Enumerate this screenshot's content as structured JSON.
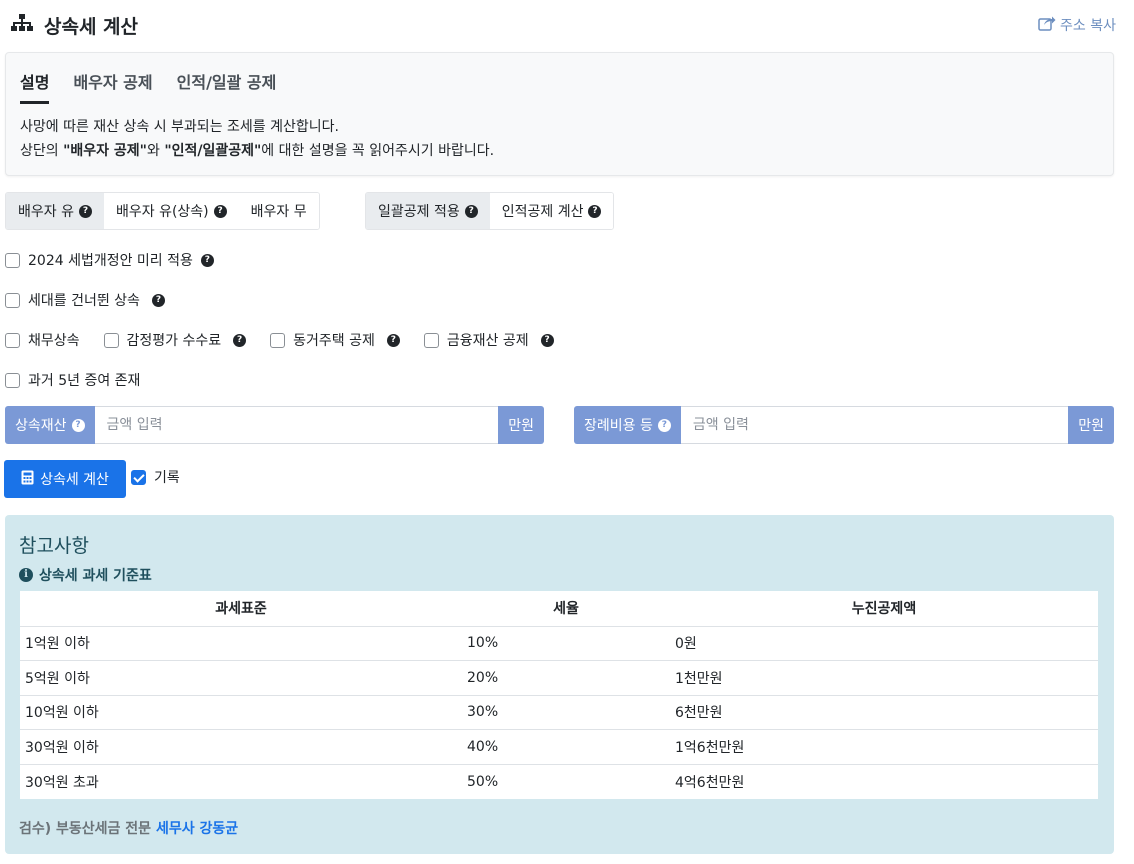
{
  "header": {
    "title": "상속세 계산",
    "share_label": "주소 복사",
    "title_icon": "sitemap-icon",
    "share_icon": "share-icon"
  },
  "desc": {
    "tabs": [
      {
        "label": "설명",
        "active": true
      },
      {
        "label": "배우자 공제",
        "active": false
      },
      {
        "label": "인적/일괄 공제",
        "active": false
      }
    ],
    "line1": "사망에 따른 재산 상속 시 부과되는 조세를 계산합니다.",
    "line2_prefix": "상단의 ",
    "line2_b1": "\"배우자 공제\"",
    "line2_mid": "와 ",
    "line2_b2": "\"인적/일괄공제\"",
    "line2_suffix": "에 대한 설명을 꼭 읽어주시기 바랍니다."
  },
  "spouse_options": [
    {
      "label": "배우자 유",
      "help": true,
      "active": true
    },
    {
      "label": "배우자 유(상속)",
      "help": true,
      "active": false
    },
    {
      "label": "배우자 무",
      "help": false,
      "active": false
    }
  ],
  "deduction_options": [
    {
      "label": "일괄공제 적용",
      "help": true,
      "active": true
    },
    {
      "label": "인적공제 계산",
      "help": true,
      "active": false
    }
  ],
  "checkboxes": {
    "row1": [
      {
        "label": "2024 세법개정안 미리 적용",
        "checked": false
      }
    ],
    "row2": [
      {
        "label": "세대를 건너뛴 상속",
        "checked": false
      }
    ],
    "row3": [
      {
        "label": "채무상속",
        "checked": false
      },
      {
        "label": "감정평가 수수료",
        "checked": false
      },
      {
        "label": "동거주택 공제",
        "checked": false
      },
      {
        "label": "금융재산 공제",
        "checked": false
      }
    ],
    "row4": [
      {
        "label": "과거 5년 증여 존재",
        "checked": false
      }
    ]
  },
  "inputs": {
    "estate": {
      "label": "상속재산",
      "placeholder": "금액 입력",
      "unit": "만원"
    },
    "funeral": {
      "label": "장례비용 등",
      "placeholder": "금액 입력",
      "unit": "만원"
    }
  },
  "actions": {
    "calc_label": "상속세 계산",
    "record_label": "기록",
    "record_checked": true
  },
  "reference": {
    "title": "참고사항",
    "subtitle": "상속세 과세 기준표",
    "table": {
      "headers": [
        "과세표준",
        "세율",
        "누진공제액"
      ],
      "rows": [
        [
          "1억원 이하",
          "10%",
          "0원"
        ],
        [
          "5억원 이하",
          "20%",
          "1천만원"
        ],
        [
          "10억원 이하",
          "30%",
          "6천만원"
        ],
        [
          "30억원 이하",
          "40%",
          "1억6천만원"
        ],
        [
          "30억원 초과",
          "50%",
          "4억6천만원"
        ]
      ]
    },
    "reviewer_prefix": "검수) 부동산세금 전문 ",
    "reviewer_name": "세무사 강동균"
  },
  "colors": {
    "primary": "#1a73e8",
    "input_label": "#7b99d6",
    "reference_bg": "#d2e8ee"
  }
}
